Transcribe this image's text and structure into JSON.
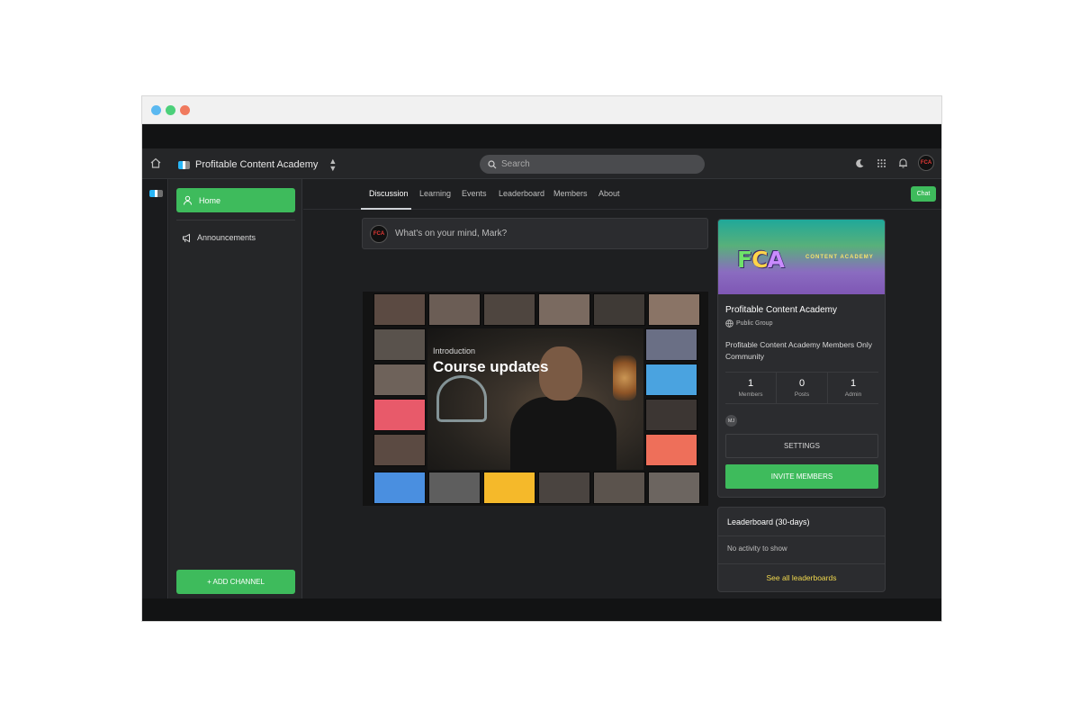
{
  "window": {
    "traffic_lights": [
      "#5ab8f0",
      "#4cd07a",
      "#f07a5e"
    ]
  },
  "header": {
    "brand_name": "Profitable Content Academy",
    "search_placeholder": "Search"
  },
  "sidebar": {
    "home_label": "Home",
    "channels": [
      {
        "label": "Announcements",
        "icon": "megaphone-icon"
      }
    ],
    "add_channel_label": "+ ADD CHANNEL"
  },
  "tabs": {
    "items": [
      "Discussion",
      "Learning",
      "Events",
      "Leaderboard",
      "Members",
      "About"
    ],
    "active": "Discussion",
    "chat_label": "Chat"
  },
  "composer": {
    "prompt": "What's on your mind, Mark?",
    "avatar_text": "FCA"
  },
  "video": {
    "kicker": "Introduction",
    "title": "Course updates"
  },
  "group": {
    "banner_logo": "FCA",
    "banner_subtitle": "CONTENT ACADEMY",
    "name": "Profitable Content Academy",
    "type": "Public Group",
    "description": "Profitable Content Academy Members Only Community",
    "stats": [
      {
        "value": "1",
        "label": "Members"
      },
      {
        "value": "0",
        "label": "Posts"
      },
      {
        "value": "1",
        "label": "Admin"
      }
    ],
    "admin_initials": "MJ",
    "settings_label": "SETTINGS",
    "invite_label": "INVITE MEMBERS"
  },
  "leaderboard": {
    "title": "Leaderboard (30-days)",
    "empty_text": "No activity to show",
    "link_label": "See all leaderboards"
  },
  "colors": {
    "accent_green": "#3ebb5c",
    "link_yellow": "#f2d94e",
    "background": "#1e1f21"
  }
}
